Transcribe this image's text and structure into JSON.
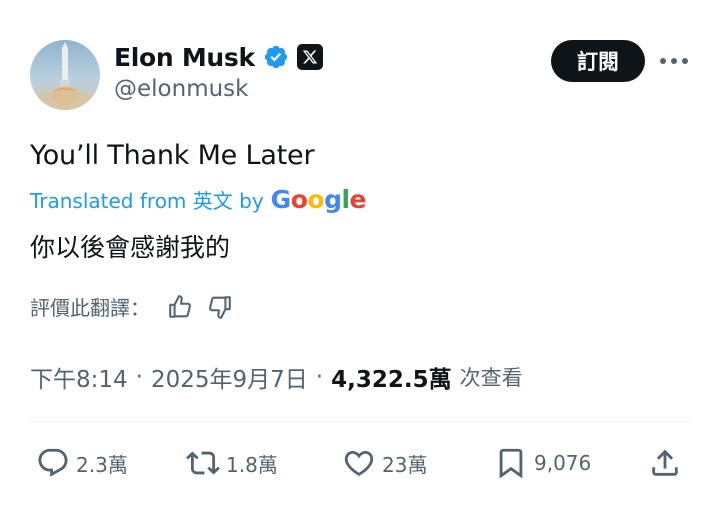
{
  "author": {
    "name": "Elon Musk",
    "handle": "@elonmusk"
  },
  "header": {
    "subscribe_label": "訂閱"
  },
  "tweet": {
    "text": "You’ll Thank Me Later",
    "translated_prefix": "Translated from 英文 by",
    "translator_brand": "Google",
    "translation": "你以後會感謝我的",
    "rate_prompt": "評價此翻譯："
  },
  "meta": {
    "time": "下午8:14",
    "separator": "·",
    "date": "2025年9月7日",
    "views_count": "4,322.5萬",
    "views_label": "次查看"
  },
  "actions": {
    "replies": "2.3萬",
    "reposts": "1.8萬",
    "likes": "23萬",
    "bookmarks": "9,076"
  },
  "colors": {
    "accent": "#1d9bf0",
    "text": "#0f1419",
    "muted": "#536471",
    "google_blue": "#4285F4",
    "google_red": "#EA4335",
    "google_yellow": "#FBBC05",
    "google_green": "#34A853"
  }
}
